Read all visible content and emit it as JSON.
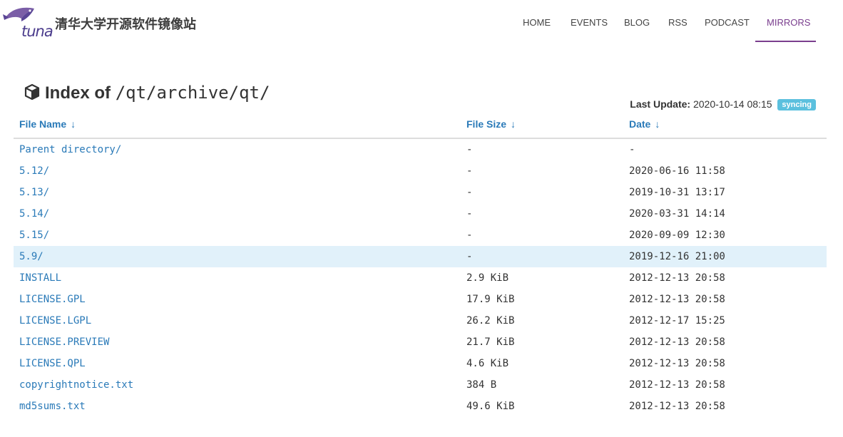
{
  "header": {
    "logo_word": "tuna",
    "site_title": "清华大学开源软件镜像站",
    "nav": [
      {
        "label": "HOME"
      },
      {
        "label": "EVENTS"
      },
      {
        "label": "BLOG"
      },
      {
        "label": "RSS"
      },
      {
        "label": "PODCAST"
      },
      {
        "label": "MIRRORS",
        "active": true
      }
    ]
  },
  "page": {
    "heading_prefix": "Index of",
    "heading_path": "/qt/archive/qt/",
    "last_update_label": "Last Update:",
    "last_update_value": "2020-10-14 08:15",
    "status_badge": "syncing"
  },
  "table": {
    "columns": [
      {
        "label": "File Name",
        "arrow": "↓"
      },
      {
        "label": "File Size",
        "arrow": "↓"
      },
      {
        "label": "Date",
        "arrow": "↓"
      }
    ],
    "rows": [
      {
        "name": "Parent directory/",
        "size": "-",
        "date": "-"
      },
      {
        "name": "5.12/",
        "size": "-",
        "date": "2020-06-16 11:58"
      },
      {
        "name": "5.13/",
        "size": "-",
        "date": "2019-10-31 13:17"
      },
      {
        "name": "5.14/",
        "size": "-",
        "date": "2020-03-31 14:14"
      },
      {
        "name": "5.15/",
        "size": "-",
        "date": "2020-09-09 12:30"
      },
      {
        "name": "5.9/",
        "size": "-",
        "date": "2019-12-16 21:00",
        "highlighted": true
      },
      {
        "name": "INSTALL",
        "size": "2.9 KiB",
        "date": "2012-12-13 20:58"
      },
      {
        "name": "LICENSE.GPL",
        "size": "17.9 KiB",
        "date": "2012-12-13 20:58"
      },
      {
        "name": "LICENSE.LGPL",
        "size": "26.2 KiB",
        "date": "2012-12-17 15:25"
      },
      {
        "name": "LICENSE.PREVIEW",
        "size": "21.7 KiB",
        "date": "2012-12-13 20:58"
      },
      {
        "name": "LICENSE.QPL",
        "size": "4.6 KiB",
        "date": "2012-12-13 20:58"
      },
      {
        "name": "copyrightnotice.txt",
        "size": "384 B",
        "date": "2012-12-13 20:58"
      },
      {
        "name": "md5sums.txt",
        "size": "49.6 KiB",
        "date": "2012-12-13 20:58"
      }
    ]
  },
  "colors": {
    "link": "#2a7ab8",
    "accent": "#7a3e8e",
    "badge": "#5bc0de",
    "row_highlight": "#e1f1fa"
  },
  "icons": {
    "logo": "tuna-fish-logo",
    "heading": "cube-icon",
    "sort": "arrow-down-icon"
  }
}
